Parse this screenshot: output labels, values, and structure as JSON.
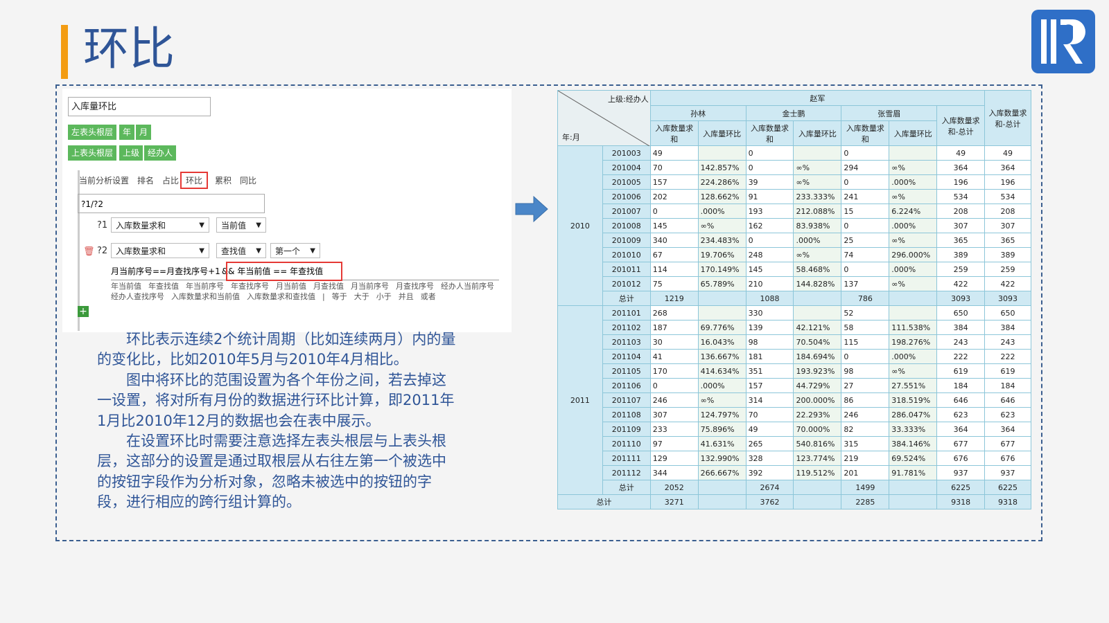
{
  "slide": {
    "title": "环比",
    "brand_color": "#2f5597",
    "accent_color": "#f39c12"
  },
  "editor": {
    "name_value": "入库量环比",
    "left_header_label": "左表头根层",
    "left_header_buttons": [
      "年",
      "月"
    ],
    "top_header_label": "上表头根层",
    "top_header_buttons": [
      "上级",
      "经办人"
    ],
    "tabs": [
      "当前分析设置",
      "排名",
      "占比",
      "环比",
      "累积",
      "同比"
    ],
    "active_tab": "环比",
    "formula": "?1/?2",
    "param1": {
      "tag": "?1",
      "field": "入库数量求和",
      "mode": "当前值"
    },
    "param2": {
      "tag": "?2",
      "field": "入库数量求和",
      "mode": "查找值",
      "pick": "第一个"
    },
    "condition_prefix": "月当前序号==月查找序号+1",
    "condition_highlight": "&&  年当前值  ==  年查找值",
    "hints": [
      "年当前值",
      "年查找值",
      "年当前序号",
      "年查找序号",
      "月当前值",
      "月查找值",
      "月当前序号",
      "月查找序号",
      "经办人当前序号",
      "经办人查找序号",
      "入库数量求和当前值",
      "入库数量求和查找值",
      "|",
      "等于",
      "大于",
      "小于",
      "并且",
      "或者"
    ],
    "add_icon": "plus-icon",
    "delete_icon": "trash-icon"
  },
  "description": {
    "p1": "环比表示连续2个统计周期（比如连续两月）内的量的变化比，比如2010年5月与2010年4月相比。",
    "p2": "图中将环比的范围设置为各个年份之间，若去掉这一设置，将对所有月份的数据进行环比计算，即2011年1月比2010年12月的数据也会在表中展示。",
    "p3": "在设置环比时需要注意选择左表头根层与上表头根层，这部分的设置是通过取根层从右往左第一个被选中的按钮字段作为分析对象，忽略未被选中的按钮的字段，进行相应的跨行组计算的。"
  },
  "table": {
    "corner_top": "上级:经办人",
    "corner_bottom": "年:月",
    "supervisor": "赵军",
    "agents": [
      "孙林",
      "金士鹏",
      "张雪眉"
    ],
    "col_sum": "入库数量求和",
    "col_ratio": "入库量环比",
    "col_sub_total": "入库数量求和-总计",
    "col_grand_total": "入库数量求和-总计",
    "total_label": "总计",
    "years": [
      {
        "year": "2010",
        "rows": [
          [
            "201003",
            "49",
            "",
            "0",
            "",
            "0",
            "",
            "49",
            "49"
          ],
          [
            "201004",
            "70",
            "142.857%",
            "0",
            "∞%",
            "294",
            "∞%",
            "364",
            "364"
          ],
          [
            "201005",
            "157",
            "224.286%",
            "39",
            "∞%",
            "0",
            ".000%",
            "196",
            "196"
          ],
          [
            "201006",
            "202",
            "128.662%",
            "91",
            "233.333%",
            "241",
            "∞%",
            "534",
            "534"
          ],
          [
            "201007",
            "0",
            ".000%",
            "193",
            "212.088%",
            "15",
            "6.224%",
            "208",
            "208"
          ],
          [
            "201008",
            "145",
            "∞%",
            "162",
            "83.938%",
            "0",
            ".000%",
            "307",
            "307"
          ],
          [
            "201009",
            "340",
            "234.483%",
            "0",
            ".000%",
            "25",
            "∞%",
            "365",
            "365"
          ],
          [
            "201010",
            "67",
            "19.706%",
            "248",
            "∞%",
            "74",
            "296.000%",
            "389",
            "389"
          ],
          [
            "201011",
            "114",
            "170.149%",
            "145",
            "58.468%",
            "0",
            ".000%",
            "259",
            "259"
          ],
          [
            "201012",
            "75",
            "65.789%",
            "210",
            "144.828%",
            "137",
            "∞%",
            "422",
            "422"
          ]
        ],
        "total": [
          "1219",
          "",
          "1088",
          "",
          "786",
          "",
          "3093",
          "3093"
        ]
      },
      {
        "year": "2011",
        "rows": [
          [
            "201101",
            "268",
            "",
            "330",
            "",
            "52",
            "",
            "650",
            "650"
          ],
          [
            "201102",
            "187",
            "69.776%",
            "139",
            "42.121%",
            "58",
            "111.538%",
            "384",
            "384"
          ],
          [
            "201103",
            "30",
            "16.043%",
            "98",
            "70.504%",
            "115",
            "198.276%",
            "243",
            "243"
          ],
          [
            "201104",
            "41",
            "136.667%",
            "181",
            "184.694%",
            "0",
            ".000%",
            "222",
            "222"
          ],
          [
            "201105",
            "170",
            "414.634%",
            "351",
            "193.923%",
            "98",
            "∞%",
            "619",
            "619"
          ],
          [
            "201106",
            "0",
            ".000%",
            "157",
            "44.729%",
            "27",
            "27.551%",
            "184",
            "184"
          ],
          [
            "201107",
            "246",
            "∞%",
            "314",
            "200.000%",
            "86",
            "318.519%",
            "646",
            "646"
          ],
          [
            "201108",
            "307",
            "124.797%",
            "70",
            "22.293%",
            "246",
            "286.047%",
            "623",
            "623"
          ],
          [
            "201109",
            "233",
            "75.896%",
            "49",
            "70.000%",
            "82",
            "33.333%",
            "364",
            "364"
          ],
          [
            "201110",
            "97",
            "41.631%",
            "265",
            "540.816%",
            "315",
            "384.146%",
            "677",
            "677"
          ],
          [
            "201111",
            "129",
            "132.990%",
            "328",
            "123.774%",
            "219",
            "69.524%",
            "676",
            "676"
          ],
          [
            "201112",
            "344",
            "266.667%",
            "392",
            "119.512%",
            "201",
            "91.781%",
            "937",
            "937"
          ]
        ],
        "total": [
          "2052",
          "",
          "2674",
          "",
          "1499",
          "",
          "6225",
          "6225"
        ]
      }
    ],
    "grand_total": [
      "3271",
      "",
      "3762",
      "",
      "2285",
      "",
      "9318",
      "9318"
    ]
  }
}
